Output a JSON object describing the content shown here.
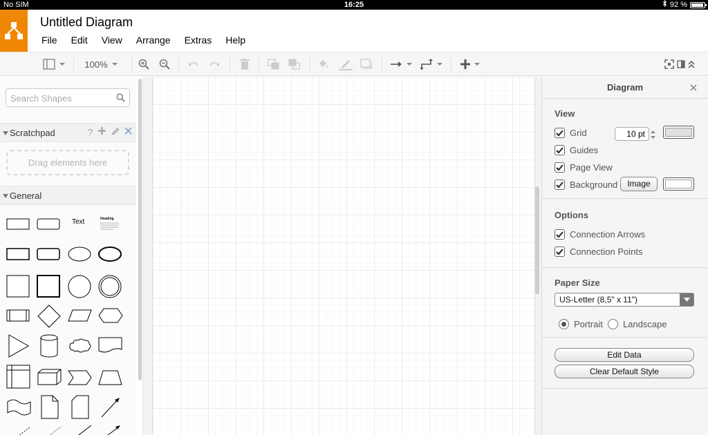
{
  "status_bar": {
    "carrier": "No SIM",
    "time": "16:25",
    "battery": "92 %",
    "battery_level": 0.92
  },
  "app": {
    "title": "Untitled Diagram",
    "accent": "#f08705"
  },
  "menu": [
    "File",
    "Edit",
    "View",
    "Arrange",
    "Extras",
    "Help"
  ],
  "toolbar": {
    "zoom": "100%"
  },
  "sidebar": {
    "search_placeholder": "Search Shapes",
    "scratchpad": {
      "label": "Scratchpad",
      "help": "?",
      "dropzone": "Drag elements here"
    },
    "general": {
      "label": "General",
      "text_shape": "Text",
      "heading_shape": "Heading"
    }
  },
  "panel": {
    "title": "Diagram",
    "view": {
      "title": "View",
      "grid": "Grid",
      "grid_size": "10 pt",
      "guides": "Guides",
      "page_view": "Page View",
      "background": "Background",
      "image_button": "Image"
    },
    "options": {
      "title": "Options",
      "connection_arrows": "Connection Arrows",
      "connection_points": "Connection Points"
    },
    "paper": {
      "title": "Paper Size",
      "size": "US-Letter (8,5\" x 11\")",
      "portrait": "Portrait",
      "landscape": "Landscape"
    },
    "actions": {
      "edit_data": "Edit Data",
      "clear_default_style": "Clear Default Style"
    }
  }
}
